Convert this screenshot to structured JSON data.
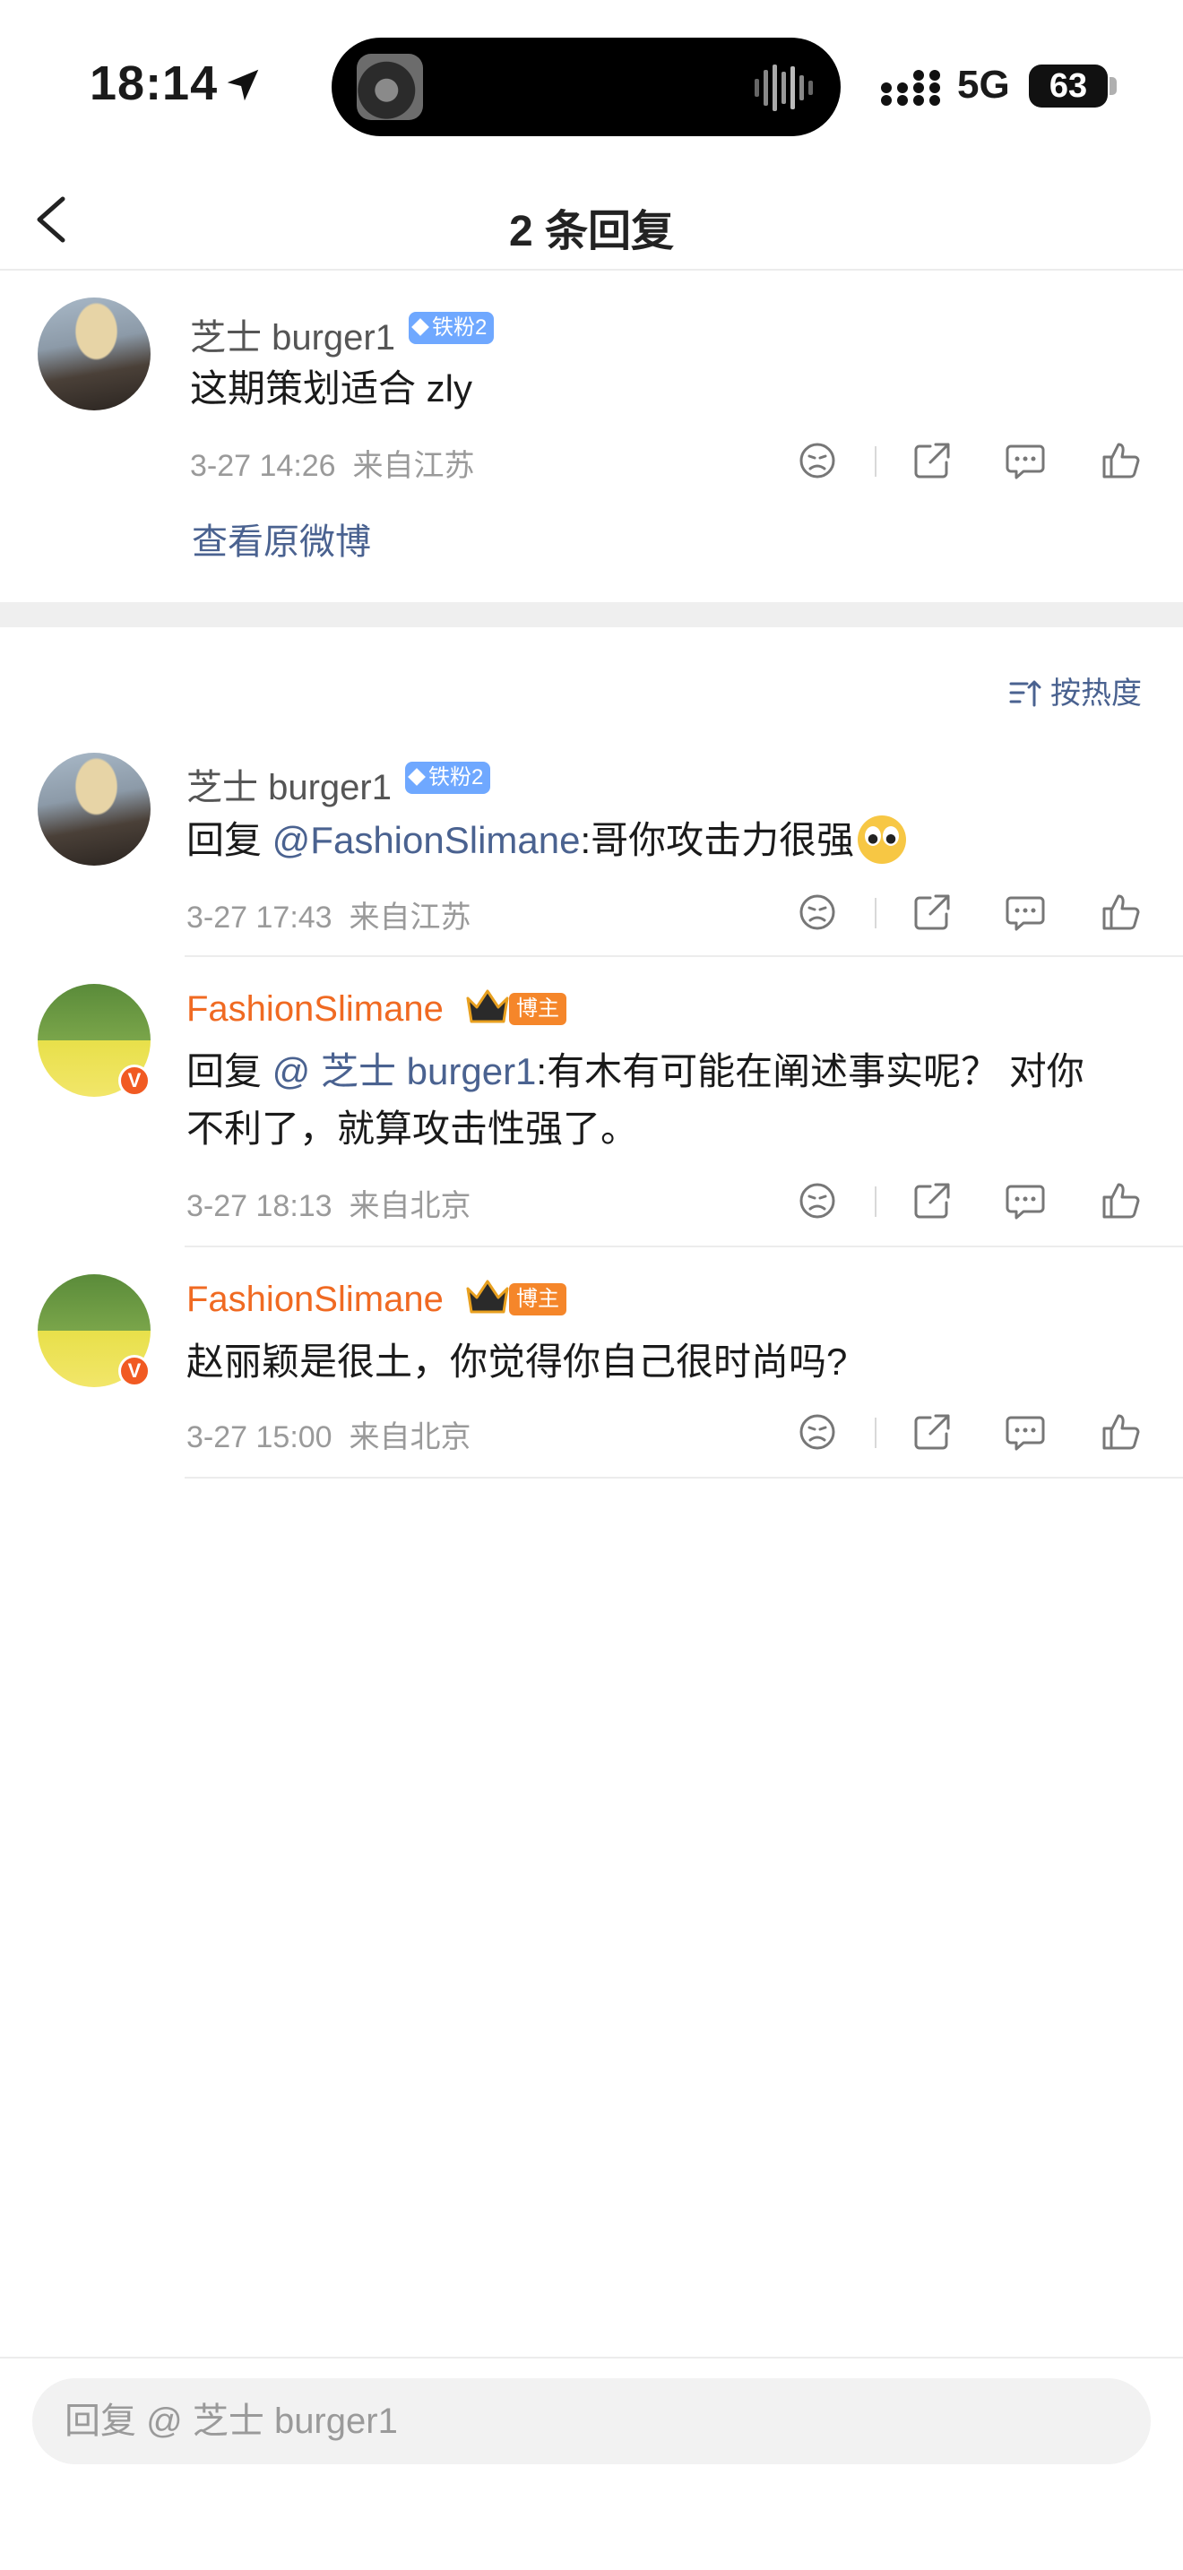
{
  "status": {
    "time": "18:14",
    "network": "5G",
    "battery": "63"
  },
  "nav": {
    "title": "2 条回复"
  },
  "root_comment": {
    "user": "芝士 burger1",
    "fan_badge": "铁粉2",
    "text": "这期策划适合 zly",
    "time": "3-27 14:26",
    "location": "来自江苏",
    "view_original": "查看原微博"
  },
  "sort": {
    "label": "按热度"
  },
  "replies": [
    {
      "user": "芝士 burger1",
      "fan_badge": "铁粉2",
      "prefix": "回复 ",
      "mention": "@FashionSlimane",
      "text": ":哥你攻击力很强",
      "time": "3-27 17:43",
      "location": "来自江苏"
    },
    {
      "user": "FashionSlimane",
      "blogger_badge": "博主",
      "prefix": "回复 ",
      "mention": "@ 芝士 burger1",
      "text_line1": ":有木有可能在阐述事实呢？ 对你",
      "text_line2": "不利了，就算攻击性强了。",
      "time": "3-27 18:13",
      "location": "来自北京"
    },
    {
      "user": "FashionSlimane",
      "blogger_badge": "博主",
      "text": "赵丽颖是很土，你觉得你自己很时尚吗?",
      "time": "3-27 15:00",
      "location": "来自北京"
    }
  ],
  "reply_box": {
    "placeholder": "回复 @ 芝士 burger1"
  }
}
